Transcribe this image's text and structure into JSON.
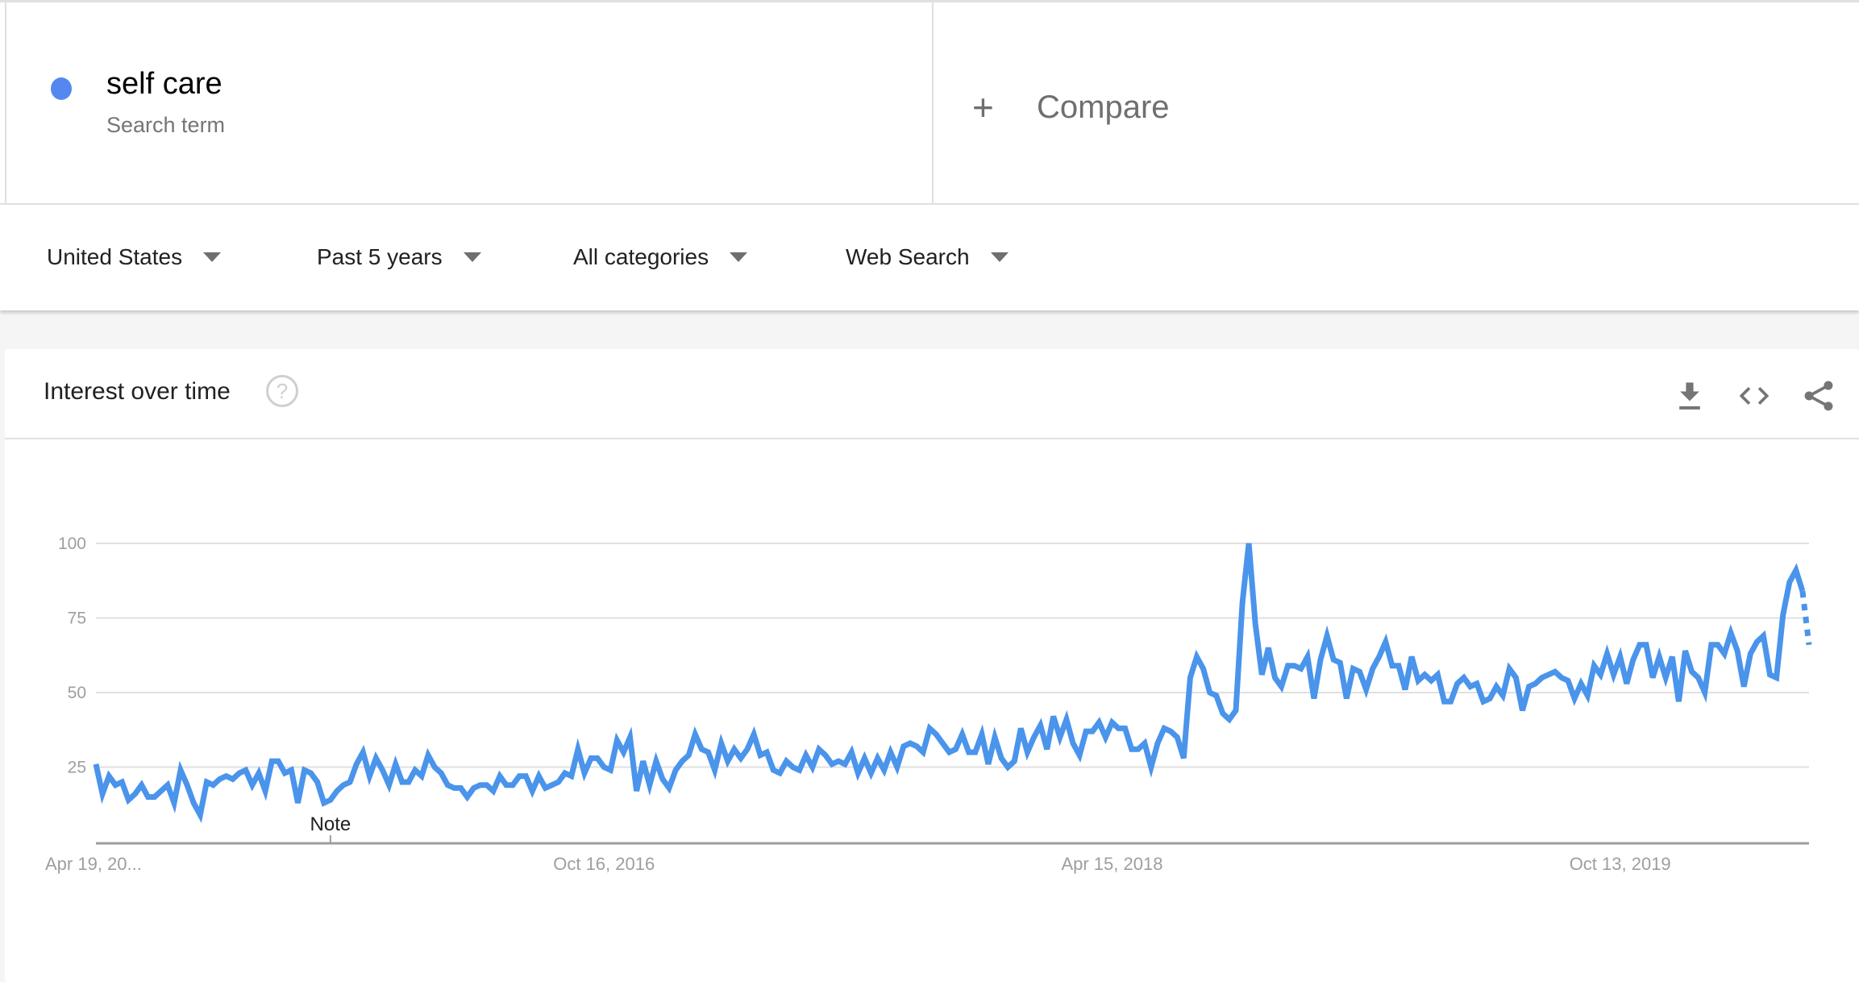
{
  "search_term": {
    "name": "self care",
    "type_label": "Search term",
    "color": "#5488f0"
  },
  "compare": {
    "icon": "plus-icon",
    "label": "Compare"
  },
  "filters": [
    {
      "label": "United States",
      "icon": "caret-down-icon"
    },
    {
      "label": "Past 5 years",
      "icon": "caret-down-icon"
    },
    {
      "label": "All categories",
      "icon": "caret-down-icon"
    },
    {
      "label": "Web Search",
      "icon": "caret-down-icon"
    }
  ],
  "card": {
    "title": "Interest over time",
    "help_icon": "?",
    "actions": [
      "download-icon",
      "embed-code-icon",
      "share-icon"
    ]
  },
  "chart_data": {
    "type": "line",
    "title": "Interest over time",
    "xlabel": "",
    "ylabel": "",
    "ylim": [
      0,
      100
    ],
    "yticks": [
      25,
      50,
      75,
      100
    ],
    "xtick_labels": [
      {
        "label": "Apr 19, 20...",
        "index": 0
      },
      {
        "label": "Oct 16, 2016",
        "index": 78
      },
      {
        "label": "Apr 15, 2018",
        "index": 156
      },
      {
        "label": "Oct 13, 2019",
        "index": 234
      }
    ],
    "annotation": {
      "label": "Note",
      "index": 36
    },
    "grid": true,
    "line_color": "#4a94eb",
    "partial_last_point": true,
    "series": [
      {
        "name": "self care",
        "values": [
          26,
          16,
          22,
          19,
          20,
          14,
          16,
          19,
          15,
          15,
          17,
          19,
          13,
          24,
          19,
          13,
          9,
          20,
          19,
          21,
          22,
          21,
          23,
          24,
          19,
          23,
          17,
          27,
          27,
          23,
          24,
          13,
          24,
          23,
          20,
          13,
          14,
          17,
          19,
          20,
          26,
          30,
          22,
          28,
          24,
          19,
          26,
          20,
          20,
          24,
          22,
          29,
          25,
          23,
          19,
          18,
          18,
          15,
          18,
          19,
          19,
          17,
          22,
          19,
          19,
          22,
          22,
          17,
          22,
          18,
          19,
          20,
          23,
          22,
          31,
          23,
          28,
          28,
          25,
          24,
          34,
          30,
          35,
          17,
          27,
          19,
          27,
          21,
          18,
          24,
          27,
          29,
          36,
          31,
          30,
          24,
          33,
          27,
          31,
          28,
          31,
          36,
          29,
          30,
          24,
          23,
          27,
          25,
          24,
          29,
          25,
          31,
          29,
          26,
          27,
          26,
          30,
          23,
          28,
          23,
          28,
          24,
          30,
          25,
          32,
          33,
          32,
          30,
          38,
          36,
          33,
          30,
          31,
          36,
          30,
          30,
          36,
          26,
          35,
          28,
          25,
          27,
          38,
          30,
          35,
          39,
          31,
          42,
          35,
          41,
          33,
          29,
          37,
          37,
          40,
          35,
          40,
          38,
          38,
          31,
          31,
          33,
          25,
          33,
          38,
          37,
          35,
          28,
          55,
          62,
          58,
          50,
          49,
          43,
          41,
          44,
          80,
          100,
          73,
          56,
          65,
          55,
          52,
          59,
          59,
          58,
          62,
          48,
          61,
          69,
          61,
          60,
          48,
          58,
          57,
          51,
          58,
          62,
          67,
          59,
          59,
          51,
          62,
          54,
          56,
          54,
          56,
          47,
          47,
          53,
          55,
          52,
          53,
          47,
          48,
          52,
          49,
          58,
          55,
          44,
          52,
          53,
          55,
          56,
          57,
          55,
          54,
          48,
          53,
          49,
          59,
          56,
          63,
          56,
          62,
          53,
          61,
          66,
          66,
          55,
          62,
          55,
          62,
          47,
          64,
          57,
          55,
          50,
          66,
          66,
          63,
          70,
          64,
          52,
          63,
          67,
          69,
          56,
          55,
          76,
          87,
          91,
          84,
          66
        ]
      }
    ]
  }
}
